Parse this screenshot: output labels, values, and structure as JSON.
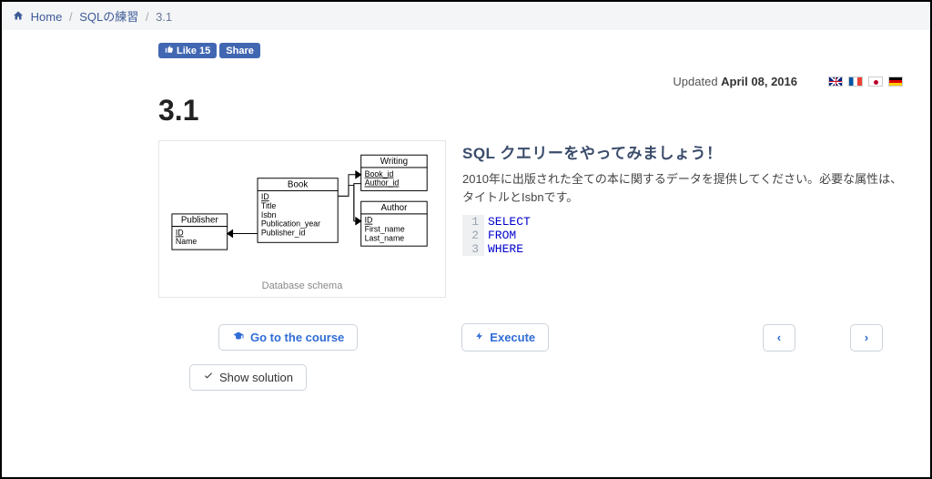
{
  "breadcrumb": {
    "home": "Home",
    "mid": "SQLの練習",
    "current": "3.1"
  },
  "social": {
    "like_label": "Like",
    "like_count": "15",
    "share_label": "Share"
  },
  "meta": {
    "updated_prefix": "Updated ",
    "updated_date": "April 08, 2016"
  },
  "flags": [
    "uk",
    "fr",
    "jp",
    "de"
  ],
  "title": "3.1",
  "schema": {
    "caption": "Database schema",
    "entities": {
      "publisher": {
        "name": "Publisher",
        "attrs": [
          "ID",
          "Name"
        ],
        "pk": [
          "ID"
        ]
      },
      "book": {
        "name": "Book",
        "attrs": [
          "ID",
          "Title",
          "Isbn",
          "Publication_year",
          "Publisher_id"
        ],
        "pk": [
          "ID"
        ]
      },
      "writing": {
        "name": "Writing",
        "attrs": [
          "Book_id",
          "Author_id"
        ],
        "pk": [
          "Book_id",
          "Author_id"
        ]
      },
      "author": {
        "name": "Author",
        "attrs": [
          "ID",
          "First_name",
          "Last_name"
        ],
        "pk": [
          "ID"
        ]
      }
    }
  },
  "lesson": {
    "heading": "SQL クエリーをやってみましょう！",
    "description": "2010年に出版された全ての本に関するデータを提供してください。必要な属性は、タイトルとIsbnです。"
  },
  "editor": {
    "lines": [
      "SELECT",
      "FROM",
      "WHERE"
    ]
  },
  "buttons": {
    "course": "Go to the course",
    "execute": "Execute",
    "solution": "Show solution",
    "prev": "‹",
    "next": "›"
  }
}
